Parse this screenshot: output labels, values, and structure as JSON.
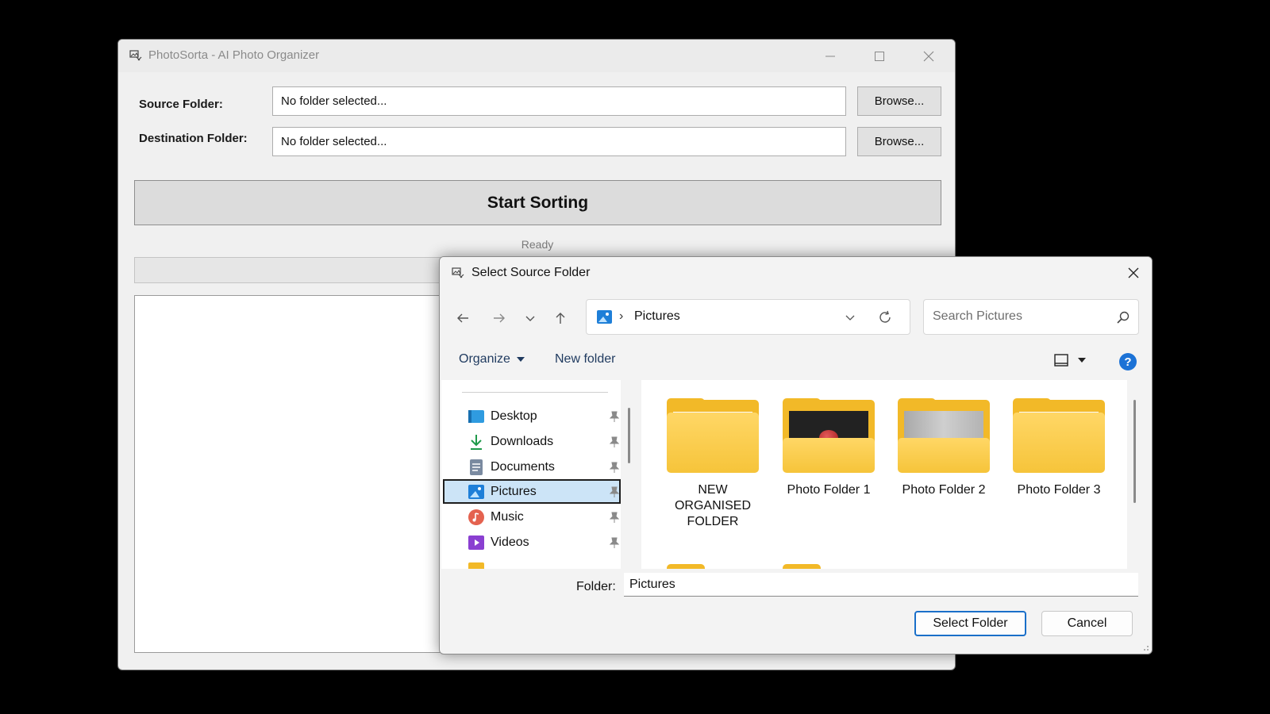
{
  "app": {
    "title": "PhotoSorta - AI Photo Organizer",
    "source_label": "Source Folder:",
    "source_value": "No folder selected...",
    "dest_label": "Destination Folder:",
    "dest_value": "No folder selected...",
    "browse_label": "Browse...",
    "start_label": "Start Sorting",
    "status": "Ready"
  },
  "dialog": {
    "title": "Select Source Folder",
    "address": "Pictures",
    "search_placeholder": "Search Pictures",
    "organize_label": "Organize",
    "new_folder_label": "New folder",
    "nav_items": [
      {
        "label": "Desktop",
        "icon": "desktop-icon",
        "color": "#2f9be0"
      },
      {
        "label": "Downloads",
        "icon": "download-icon",
        "color": "#1f9a4a"
      },
      {
        "label": "Documents",
        "icon": "documents-icon",
        "color": "#7a8aa0"
      },
      {
        "label": "Pictures",
        "icon": "pictures-icon",
        "color": "#1e7fd8"
      },
      {
        "label": "Music",
        "icon": "music-icon",
        "color": "#e4624f"
      },
      {
        "label": "Videos",
        "icon": "videos-icon",
        "color": "#8a3fd1"
      }
    ],
    "folders": [
      {
        "label": "NEW ORGANISED FOLDER"
      },
      {
        "label": "Photo Folder 1"
      },
      {
        "label": "Photo Folder 2"
      },
      {
        "label": "Photo Folder 3"
      }
    ],
    "folder_field_label": "Folder:",
    "folder_field_value": "Pictures",
    "select_label": "Select Folder",
    "cancel_label": "Cancel"
  },
  "colors": {
    "accent": "#1a6fc9",
    "selected_bg": "#cce4f7",
    "folder_yellow": "#f6c43a"
  }
}
